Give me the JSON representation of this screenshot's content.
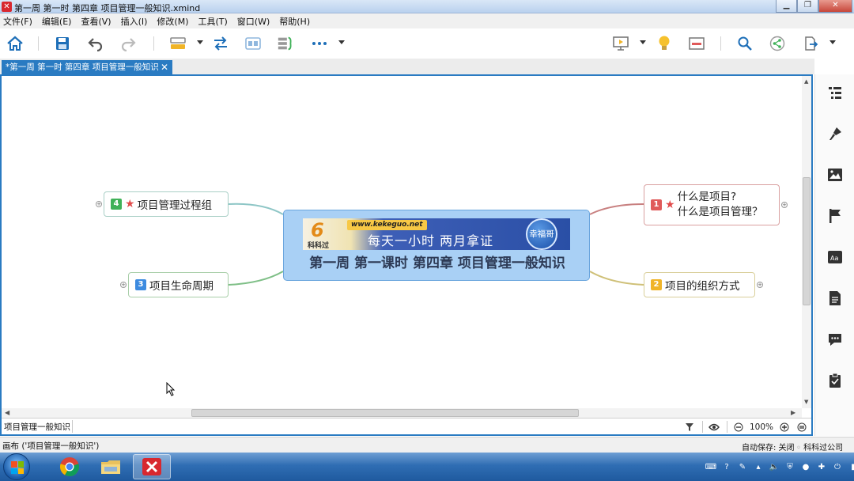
{
  "window": {
    "title": "第一周  第一时 第四章 项目管理一般知识.xmind",
    "app_icon_glyph": "✕",
    "min_glyph": "▁",
    "max_glyph": "❐",
    "close_glyph": "✕"
  },
  "menu": {
    "items": [
      "文件(F)",
      "编辑(E)",
      "查看(V)",
      "插入(I)",
      "修改(M)",
      "工具(T)",
      "窗口(W)",
      "帮助(H)"
    ]
  },
  "tab": {
    "label": "*第一周  第一时 第四章 项目管理一般知识",
    "close_glyph": "✕"
  },
  "mindmap": {
    "central": {
      "banner_url": "www.kekeguo.net",
      "banner_slogan": "每天一小时   两月拿证",
      "banner_logo_text": "科科过",
      "banner_logo_mark": "6",
      "banner_seal": "幸福哥",
      "title": "第一周 第一课时 第四章 项目管理一般知识"
    },
    "topics": [
      {
        "number": "1",
        "line1": "什么是项目?",
        "line2": "什么是项目管理？",
        "badge_color": "#e05a5a"
      },
      {
        "number": "2",
        "label": "项目的组织方式",
        "badge_color": "#f0b428"
      },
      {
        "number": "3",
        "label": "项目生命周期",
        "badge_color": "#3d8be0"
      },
      {
        "number": "4",
        "label": "项目管理过程组",
        "badge_color": "#3fb158"
      }
    ]
  },
  "canvas_status": {
    "breadcrumb": "项目管理一般知识",
    "zoom": "100%"
  },
  "app_status": {
    "left": "画布 ('项目管理一般知识')",
    "autosave": "自动保存: 关闭",
    "company": "科科过公司"
  },
  "colors": {
    "accent": "#2a7bc2",
    "central_fill": "#a9d0f5"
  }
}
